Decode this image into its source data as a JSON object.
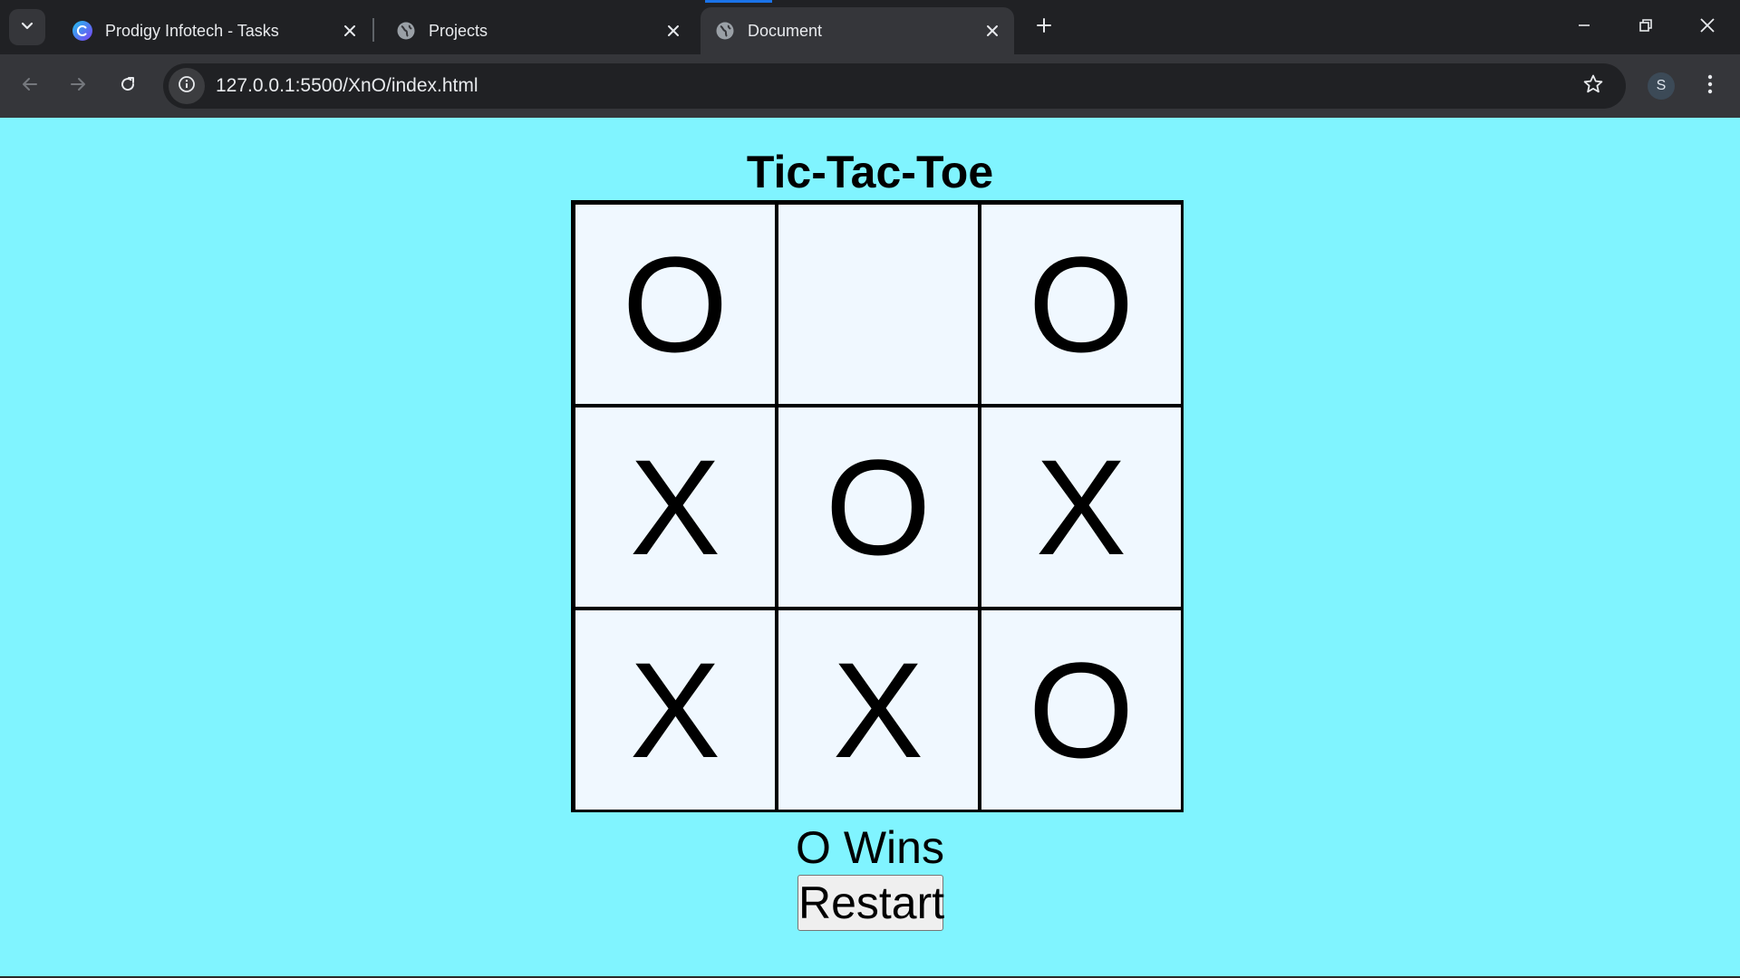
{
  "browser": {
    "tabs": [
      {
        "title": "Prodigy Infotech - Tasks",
        "active": false,
        "favicon": "canva-icon"
      },
      {
        "title": "Projects",
        "active": false,
        "favicon": "globe-icon"
      },
      {
        "title": "Document",
        "active": true,
        "favicon": "globe-icon"
      }
    ],
    "url": "127.0.0.1:5500/XnO/index.html",
    "profile_initial": "S"
  },
  "game": {
    "title": "Tic-Tac-Toe",
    "board": [
      [
        "O",
        "",
        "O"
      ],
      [
        "X",
        "O",
        "X"
      ],
      [
        "X",
        "X",
        "O"
      ]
    ],
    "status": "O Wins",
    "restart_label": "Restart"
  },
  "colors": {
    "page_background": "#80f4ff",
    "cell_background": "#f0f8ff",
    "chrome_dark": "#202124",
    "chrome_toolbar": "#35363a"
  }
}
